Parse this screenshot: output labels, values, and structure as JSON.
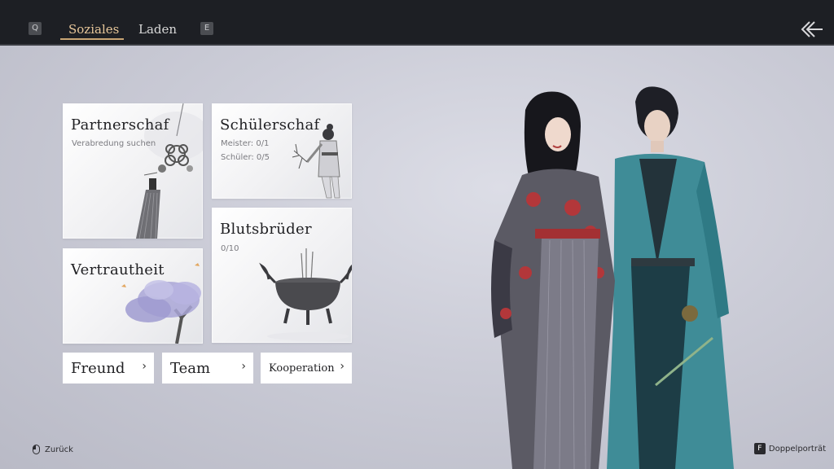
{
  "topbar": {
    "left_key": "Q",
    "right_key": "E",
    "tabs": [
      {
        "label": "Soziales",
        "active": true
      },
      {
        "label": "Laden",
        "active": false
      }
    ],
    "back_icon": "double-arrow-left-icon"
  },
  "cards": {
    "partnerschaft": {
      "title": "Partnerschaf",
      "subtitle": "Verabredung suchen"
    },
    "schuelerschaft": {
      "title": "Schülerschaf",
      "meister": "Meister: 0/1",
      "schueler": "Schüler: 0/5"
    },
    "vertrautheit": {
      "title": "Vertrautheit"
    },
    "blutsbrueder": {
      "title": "Blutsbrüder",
      "count": "0/10"
    }
  },
  "buttons": {
    "freund": {
      "label": "Freund",
      "chevron": "›"
    },
    "team": {
      "label": "Team",
      "chevron": "›"
    },
    "kooperation": {
      "label": "Kooperation",
      "chevron": "›"
    }
  },
  "hints": {
    "back": {
      "label": "Zurück",
      "icon": "mouse-icon"
    },
    "portrait": {
      "key": "F",
      "label": "Doppelporträt"
    }
  },
  "colors": {
    "accent": "#e8c79a",
    "topbar": "#1d1f24",
    "background": "#cbccd7"
  }
}
